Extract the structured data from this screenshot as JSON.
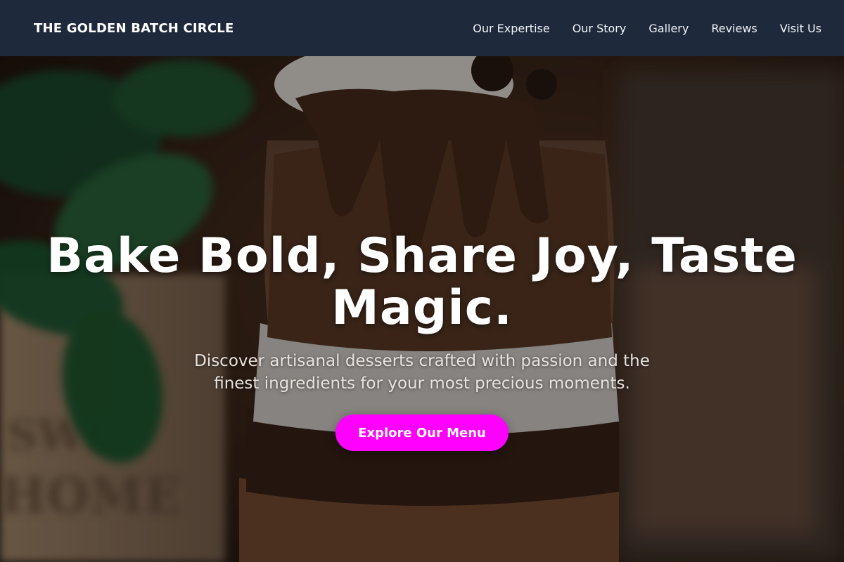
{
  "brand": {
    "name": "THE GOLDEN BATCH CIRCLE"
  },
  "nav": {
    "items": [
      {
        "label": "Our Expertise"
      },
      {
        "label": "Our Story"
      },
      {
        "label": "Gallery"
      },
      {
        "label": "Reviews"
      },
      {
        "label": "Visit Us"
      }
    ]
  },
  "hero": {
    "title": "Bake Bold, Share Joy, Taste Magic.",
    "subtitle": "Discover artisanal desserts crafted with passion and the finest ingredients for your most precious moments.",
    "cta_label": "Explore Our Menu",
    "background_image": "chocolate-dessert-parfait-photo"
  },
  "colors": {
    "navbar_bg": "#1e293b",
    "cta_bg": "#ff00ff",
    "text_white": "#ffffff"
  }
}
